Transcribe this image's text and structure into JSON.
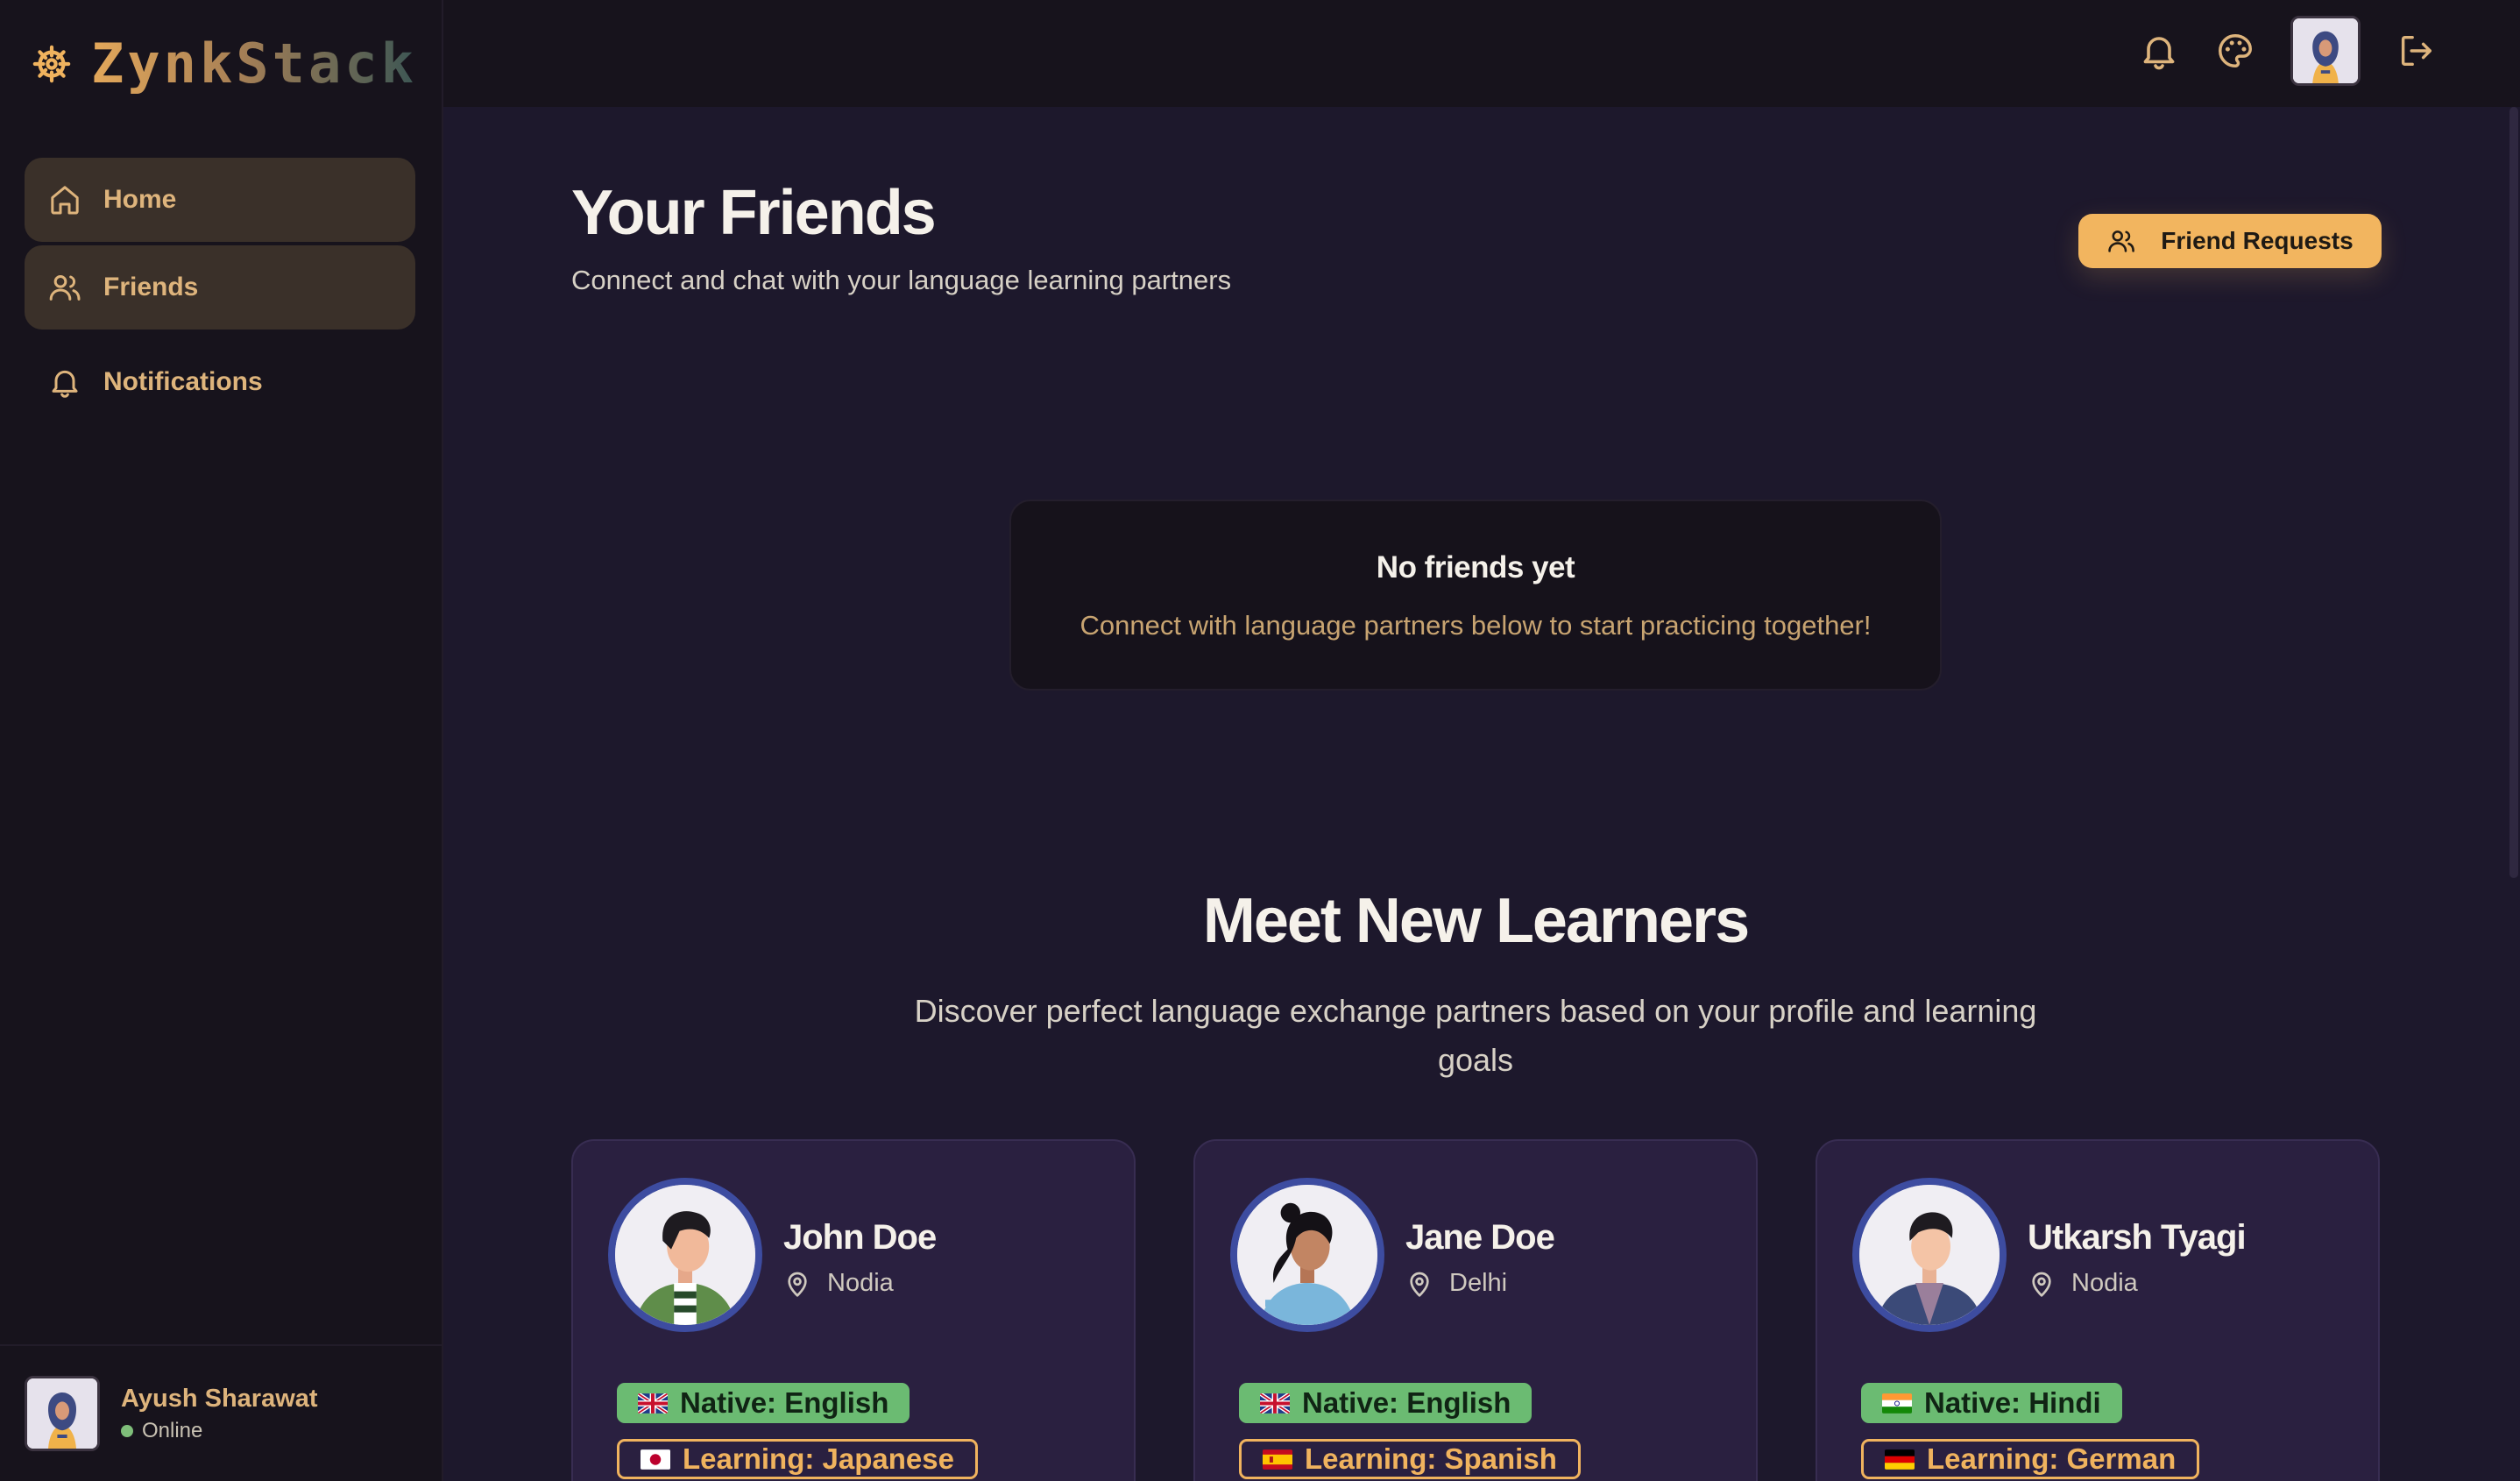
{
  "app": {
    "name": "ZynkStack",
    "logo_icon": "ship-wheel-icon"
  },
  "colors": {
    "accent": "#f2b55f",
    "nav_text": "#deb47c",
    "native_badge": "#6bbb72",
    "card_bg": "#2a2040",
    "page_bg": "#1d182c",
    "sidebar_bg": "#17131c"
  },
  "topbar": {
    "icons": [
      "bell-icon",
      "palette-icon",
      "user-avatar",
      "logout-icon"
    ]
  },
  "sidebar": {
    "items": [
      {
        "label": "Home",
        "icon": "home-icon",
        "active": true
      },
      {
        "label": "Friends",
        "icon": "users-icon",
        "active": true
      },
      {
        "label": "Notifications",
        "icon": "bell-icon",
        "active": false
      }
    ],
    "user": {
      "name": "Ayush Sharawat",
      "status": "Online"
    }
  },
  "friends": {
    "title": "Your Friends",
    "subtitle": "Connect and chat with your language learning partners",
    "requests_button": "Friend Requests",
    "empty_title": "No friends yet",
    "empty_text": "Connect with language partners below to start practicing together!"
  },
  "learners": {
    "title": "Meet New Learners",
    "subtitle": "Discover perfect language exchange partners based on your profile and learning goals",
    "cards": [
      {
        "name": "John Doe",
        "location": "Nodia",
        "native": "Native: English",
        "native_flag": "gb",
        "learning": "Learning: Japanese",
        "learning_flag": "jp"
      },
      {
        "name": "Jane Doe",
        "location": "Delhi",
        "native": "Native: English",
        "native_flag": "gb",
        "learning": "Learning: Spanish",
        "learning_flag": "es"
      },
      {
        "name": "Utkarsh Tyagi",
        "location": "Nodia",
        "native": "Native: Hindi",
        "native_flag": "in",
        "learning": "Learning: German",
        "learning_flag": "de"
      }
    ]
  }
}
